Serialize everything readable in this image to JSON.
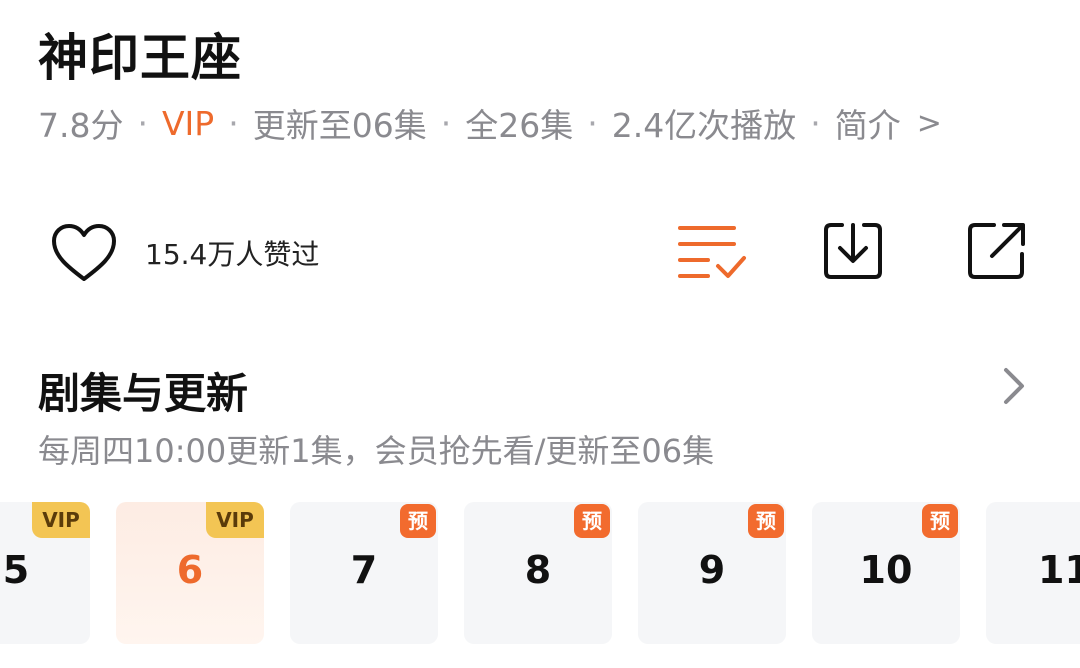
{
  "show": {
    "title": "神印王座",
    "meta": {
      "rating": "7.8分",
      "separator": "·",
      "vip": "VIP",
      "update_status": "更新至06集",
      "total": "全26集",
      "plays": "2.4亿次播放",
      "intro_link": "简介",
      "intro_chevron": ">"
    }
  },
  "actions": {
    "likes_text": "15.4万人赞过",
    "icons": [
      "heart-icon",
      "playlist-check-icon",
      "download-icon",
      "share-icon"
    ]
  },
  "episodes_section": {
    "title": "剧集与更新",
    "subtitle": "每周四10:00更新1集，会员抢先看/更新至06集",
    "items": [
      {
        "number": "5",
        "badge": "VIP",
        "active": false
      },
      {
        "number": "6",
        "badge": "VIP",
        "active": true
      },
      {
        "number": "7",
        "badge": "预",
        "active": false
      },
      {
        "number": "8",
        "badge": "预",
        "active": false
      },
      {
        "number": "9",
        "badge": "预",
        "active": false
      },
      {
        "number": "10",
        "badge": "预",
        "active": false
      },
      {
        "number": "11",
        "badge": "",
        "active": false
      }
    ]
  },
  "colors": {
    "accent": "#ee6a2c",
    "vip_badge": "#f3c554",
    "preview_badge": "#f26b2e",
    "muted_text": "#8a8a8f",
    "card_bg": "#f5f6f8"
  }
}
